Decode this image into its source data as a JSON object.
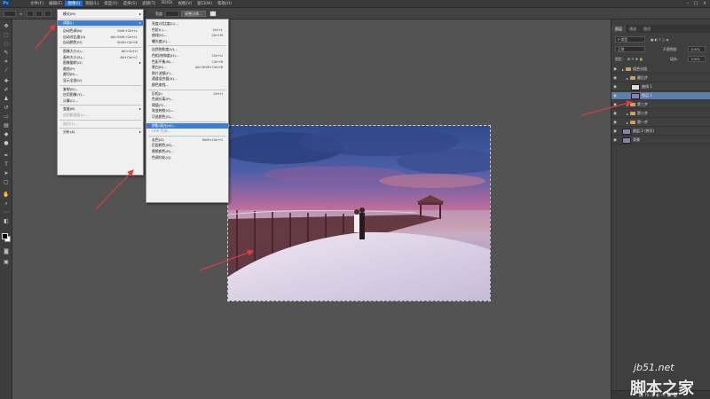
{
  "app": {
    "logo": "Ps"
  },
  "menubar": {
    "items": [
      "文件(F)",
      "编辑(E)",
      "图像(I)",
      "图层(L)",
      "类型(Y)",
      "选择(S)",
      "滤镜(T)",
      "3D(D)",
      "视图(V)",
      "窗口(W)",
      "帮助(H)"
    ],
    "active_index": 2
  },
  "optbar": {
    "label_left": "≡",
    "btn_adjust": "调整边缘...",
    "label_mid": "宽度:",
    "label_height": "高度:"
  },
  "image_menu": {
    "items": [
      {
        "label": "模式(M)",
        "shortcut": "",
        "submenu": true
      },
      {
        "sep": true
      },
      {
        "label": "调整(J)",
        "shortcut": "",
        "submenu": true,
        "highlight": true
      },
      {
        "sep": true
      },
      {
        "label": "自动色调(N)",
        "shortcut": "Shift+Ctrl+L"
      },
      {
        "label": "自动对比度(U)",
        "shortcut": "Alt+Shift+Ctrl+L"
      },
      {
        "label": "自动颜色(O)",
        "shortcut": "Shift+Ctrl+B"
      },
      {
        "sep": true
      },
      {
        "label": "图像大小(I)...",
        "shortcut": "Alt+Ctrl+I"
      },
      {
        "label": "画布大小(S)...",
        "shortcut": "Alt+Ctrl+C"
      },
      {
        "label": "图像旋转(G)",
        "shortcut": "",
        "submenu": true
      },
      {
        "label": "裁剪(P)",
        "shortcut": ""
      },
      {
        "label": "裁切(R)...",
        "shortcut": ""
      },
      {
        "label": "显示全部(V)",
        "shortcut": ""
      },
      {
        "sep": true
      },
      {
        "label": "复制(D)...",
        "shortcut": ""
      },
      {
        "label": "应用图像(Y)...",
        "shortcut": ""
      },
      {
        "label": "计算(C)...",
        "shortcut": ""
      },
      {
        "sep": true
      },
      {
        "label": "变量(B)",
        "shortcut": "",
        "submenu": true
      },
      {
        "label": "应用数据组(L)...",
        "shortcut": "",
        "disabled": true
      },
      {
        "sep": true
      },
      {
        "label": "陷印(T)...",
        "shortcut": "",
        "disabled": true
      },
      {
        "sep": true
      },
      {
        "label": "分析(A)",
        "shortcut": "",
        "submenu": true
      }
    ]
  },
  "adjust_menu": {
    "items": [
      {
        "label": "亮度/对比度(C)...",
        "shortcut": ""
      },
      {
        "label": "色阶(L)...",
        "shortcut": "Ctrl+L"
      },
      {
        "label": "曲线(U)...",
        "shortcut": "Ctrl+M"
      },
      {
        "label": "曝光度(E)...",
        "shortcut": ""
      },
      {
        "sep": true
      },
      {
        "label": "自然饱和度(V)...",
        "shortcut": ""
      },
      {
        "label": "色相/饱和度(H)...",
        "shortcut": "Ctrl+U"
      },
      {
        "label": "色彩平衡(B)...",
        "shortcut": "Ctrl+B"
      },
      {
        "label": "黑白(K)...",
        "shortcut": "Alt+Shift+Ctrl+B"
      },
      {
        "label": "照片滤镜(F)...",
        "shortcut": ""
      },
      {
        "label": "通道混合器(X)...",
        "shortcut": ""
      },
      {
        "label": "颜色查找...",
        "shortcut": ""
      },
      {
        "sep": true
      },
      {
        "label": "反相(I)",
        "shortcut": "Ctrl+I"
      },
      {
        "label": "色调分离(P)...",
        "shortcut": ""
      },
      {
        "label": "阈值(T)...",
        "shortcut": ""
      },
      {
        "label": "渐变映射(G)...",
        "shortcut": ""
      },
      {
        "label": "可选颜色(S)...",
        "shortcut": ""
      },
      {
        "sep": true
      },
      {
        "label": "阴影/高光(W)...",
        "shortcut": "",
        "highlight": true
      },
      {
        "label": "HDR 色调...",
        "shortcut": "",
        "disabled": true
      },
      {
        "sep": true
      },
      {
        "label": "去色(D)",
        "shortcut": "Shift+Ctrl+U"
      },
      {
        "label": "匹配颜色(M)...",
        "shortcut": ""
      },
      {
        "label": "替换颜色(R)...",
        "shortcut": ""
      },
      {
        "label": "色调均化(Q)",
        "shortcut": ""
      }
    ]
  },
  "layers_panel": {
    "tabs": [
      "图层",
      "通道",
      "路径"
    ],
    "kind_label": "P 类型",
    "blend_mode": "正常",
    "opacity_label": "不透明度:",
    "opacity_value": "100%",
    "lock_label": "锁定:",
    "fill_label": "填充:",
    "fill_value": "100%",
    "layers": [
      {
        "name": "组合分组",
        "type": "group",
        "indent": 0
      },
      {
        "name": "最后步",
        "type": "group",
        "indent": 1
      },
      {
        "name": "曲线 1",
        "type": "adjustment",
        "indent": 2
      },
      {
        "name": "图层 1",
        "type": "layer",
        "indent": 2,
        "selected": true
      },
      {
        "name": "第三步",
        "type": "group",
        "indent": 1
      },
      {
        "name": "第二步",
        "type": "group",
        "indent": 1
      },
      {
        "name": "第一步",
        "type": "group",
        "indent": 1
      },
      {
        "name": "图层 2 (拷贝)",
        "type": "layer",
        "indent": 0
      },
      {
        "name": "背景",
        "type": "layer",
        "indent": 0
      }
    ]
  },
  "watermark": {
    "site": "jb51.net",
    "name": "脚本之家"
  },
  "colors": {
    "accent": "#3b7ddb",
    "arrow": "#e23a3a"
  }
}
